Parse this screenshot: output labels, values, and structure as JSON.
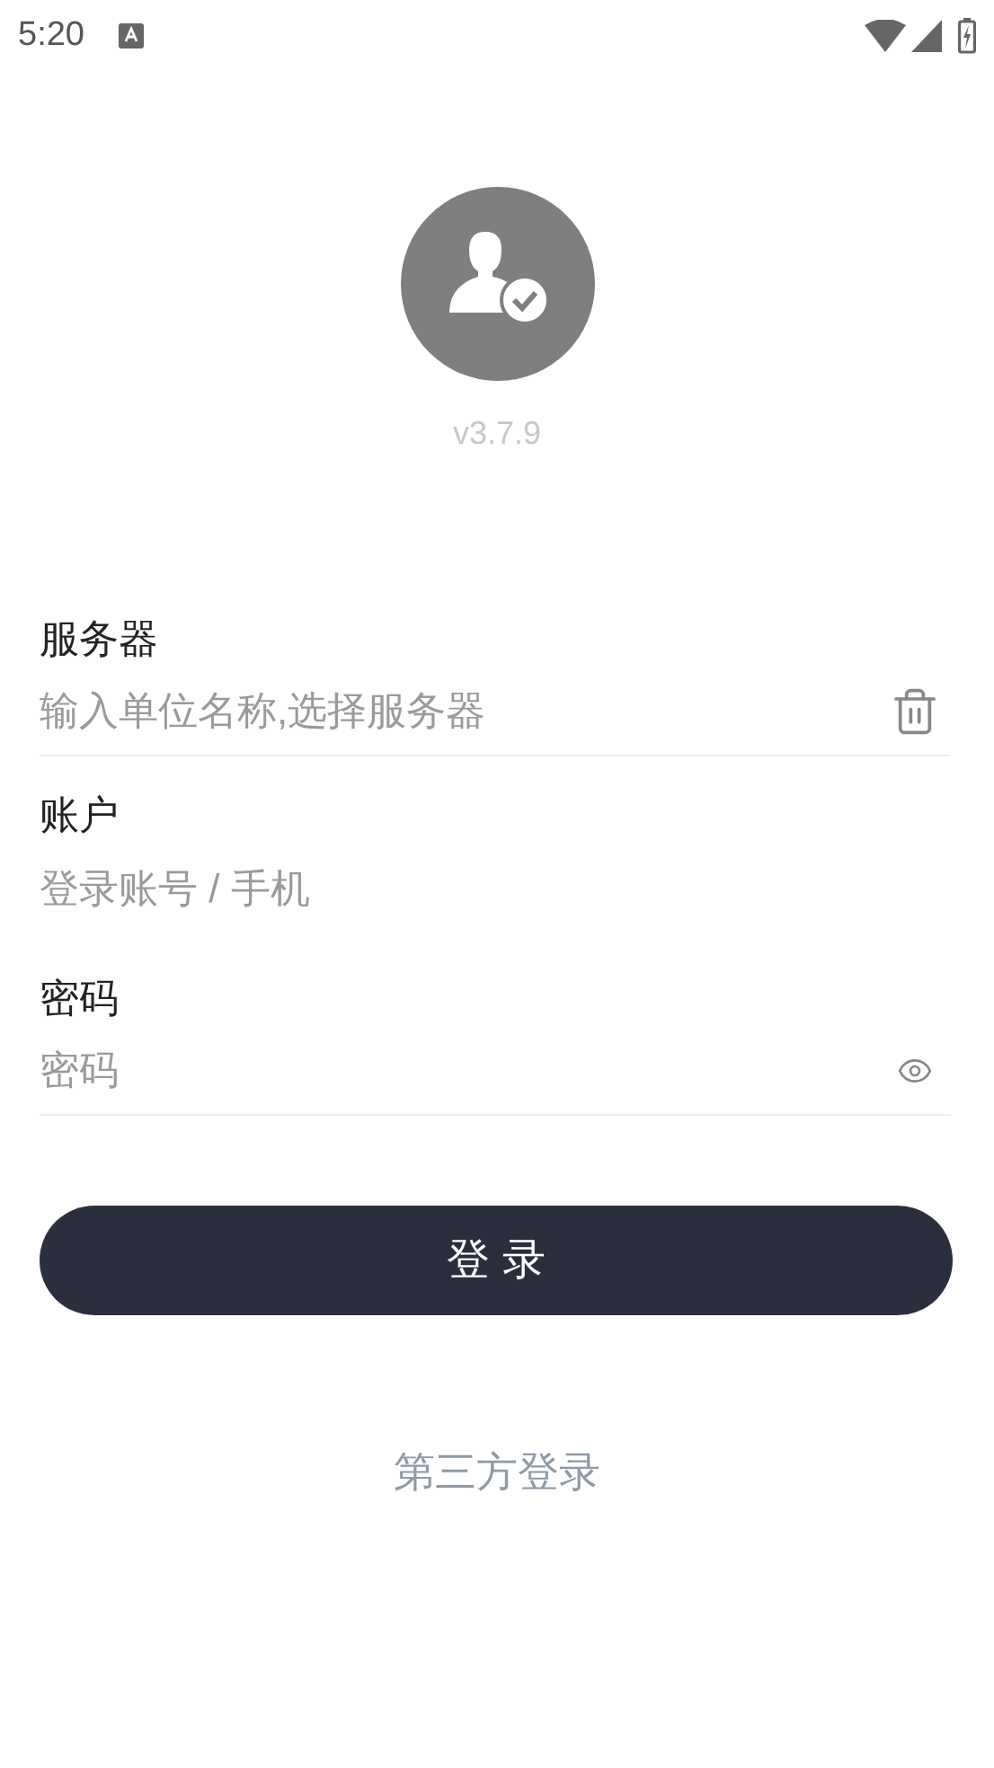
{
  "status_bar": {
    "time": "5:20"
  },
  "version": "v3.7.9",
  "fields": [
    {
      "label": "服务器",
      "placeholder": "输入单位名称,选择服务器",
      "kind": "trash",
      "underline": true
    },
    {
      "label": "账户",
      "placeholder": "登录账号 / 手机",
      "kind": "plain",
      "underline": false
    },
    {
      "label": "密码",
      "placeholder": "密码",
      "kind": "eye",
      "underline": true
    }
  ],
  "login_button": "登 录",
  "third_party_link": "第三方登录"
}
